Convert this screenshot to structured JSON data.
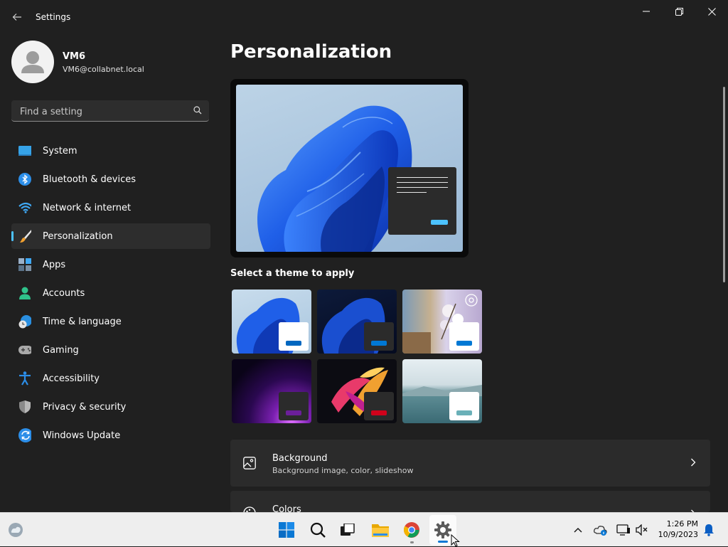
{
  "window": {
    "title": "Settings"
  },
  "profile": {
    "name": "VM6",
    "email": "VM6@collabnet.local"
  },
  "search": {
    "placeholder": "Find a setting"
  },
  "nav": {
    "items": [
      {
        "label": "System",
        "icon": "monitor-icon"
      },
      {
        "label": "Bluetooth & devices",
        "icon": "bluetooth-icon"
      },
      {
        "label": "Network & internet",
        "icon": "wifi-icon"
      },
      {
        "label": "Personalization",
        "icon": "paintbrush-icon",
        "active": true
      },
      {
        "label": "Apps",
        "icon": "apps-icon"
      },
      {
        "label": "Accounts",
        "icon": "person-icon"
      },
      {
        "label": "Time & language",
        "icon": "globe-clock-icon"
      },
      {
        "label": "Gaming",
        "icon": "gamepad-icon"
      },
      {
        "label": "Accessibility",
        "icon": "accessibility-icon"
      },
      {
        "label": "Privacy & security",
        "icon": "shield-icon"
      },
      {
        "label": "Windows Update",
        "icon": "update-icon"
      }
    ]
  },
  "main": {
    "title": "Personalization",
    "themes_heading": "Select a theme to apply",
    "themes": [
      {
        "name": "windows-light",
        "accent": "#0067c0"
      },
      {
        "name": "windows-dark",
        "accent": "#0078d4"
      },
      {
        "name": "glow-spotlight",
        "accent": "#0078d4"
      },
      {
        "name": "captured-motion",
        "accent": "#6b1f9a"
      },
      {
        "name": "flow",
        "accent": "#d0021b"
      },
      {
        "name": "sunrise-lake",
        "accent": "#6ab0b8"
      }
    ],
    "cards": [
      {
        "title": "Background",
        "subtitle": "Background image, color, slideshow",
        "icon": "image-icon"
      },
      {
        "title": "Colors",
        "subtitle": "",
        "icon": "palette-icon"
      }
    ]
  },
  "taskbar": {
    "time": "1:26 PM",
    "date": "10/9/2023",
    "apps": [
      "start-icon",
      "search-icon",
      "task-view-icon",
      "file-explorer-icon",
      "chrome-icon",
      "settings-icon"
    ]
  },
  "colors": {
    "accent": "#4cc2ff",
    "background": "#202020",
    "card": "#2b2b2b"
  }
}
